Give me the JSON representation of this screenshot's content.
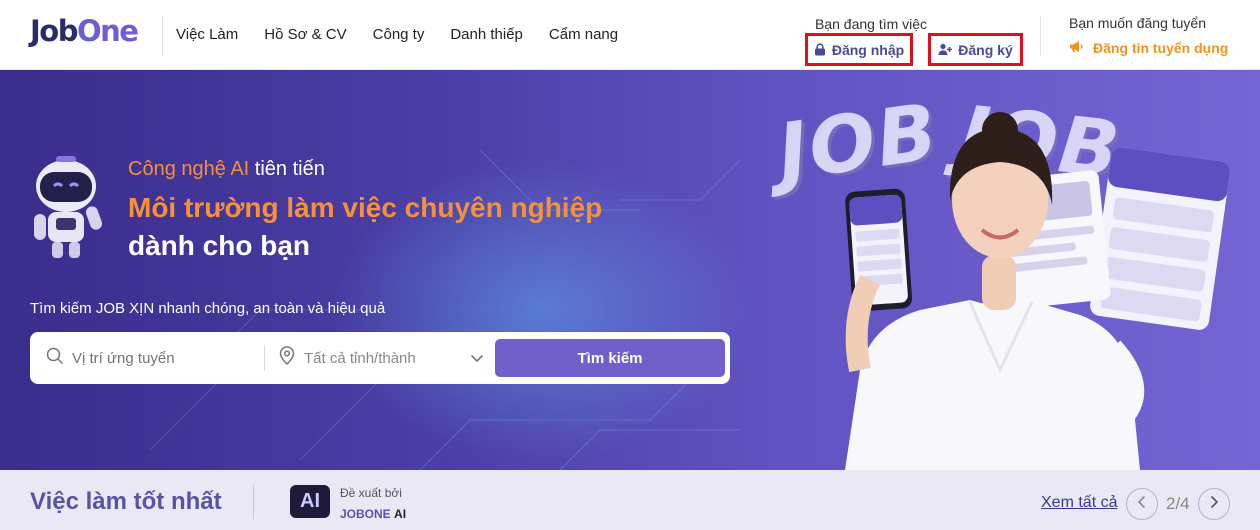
{
  "header": {
    "logo_job": "Job",
    "logo_one": "One",
    "nav": [
      "Việc Làm",
      "Hồ Sơ & CV",
      "Công ty",
      "Danh thiếp",
      "Cẩm nang"
    ],
    "seeker_label": "Bạn đang tìm việc",
    "login_label": "Đăng nhập",
    "register_label": "Đăng ký",
    "employer_label": "Bạn muốn đăng tuyển",
    "post_job_label": "Đăng tin tuyển dụng"
  },
  "hero": {
    "line1_accent": "Công nghệ AI",
    "line1_rest": " tiên tiến",
    "line2": "Môi trường làm việc chuyên nghiệp",
    "line3": "dành cho bạn",
    "subtitle": "Tìm kiếm JOB XỊN nhanh chóng, an toàn và hiệu quả",
    "search_placeholder": "Vị trí ứng tuyển",
    "location_value": "Tất cả tỉnh/thành",
    "search_button": "Tìm kiếm",
    "art_text": "JOB"
  },
  "bottom": {
    "title": "Việc làm tốt nhất",
    "ai_badge": "AI",
    "suggest_label": "Đề xuất bởi",
    "brand_main": "JOBONE",
    "brand_ai": "AI",
    "see_all": "Xem tất cả",
    "page_indicator": "2/4"
  },
  "colors": {
    "brand": "#2d2c6b",
    "accent_orange": "#f5913a",
    "primary_button": "#7160c9",
    "highlight_red": "#e0101a"
  }
}
